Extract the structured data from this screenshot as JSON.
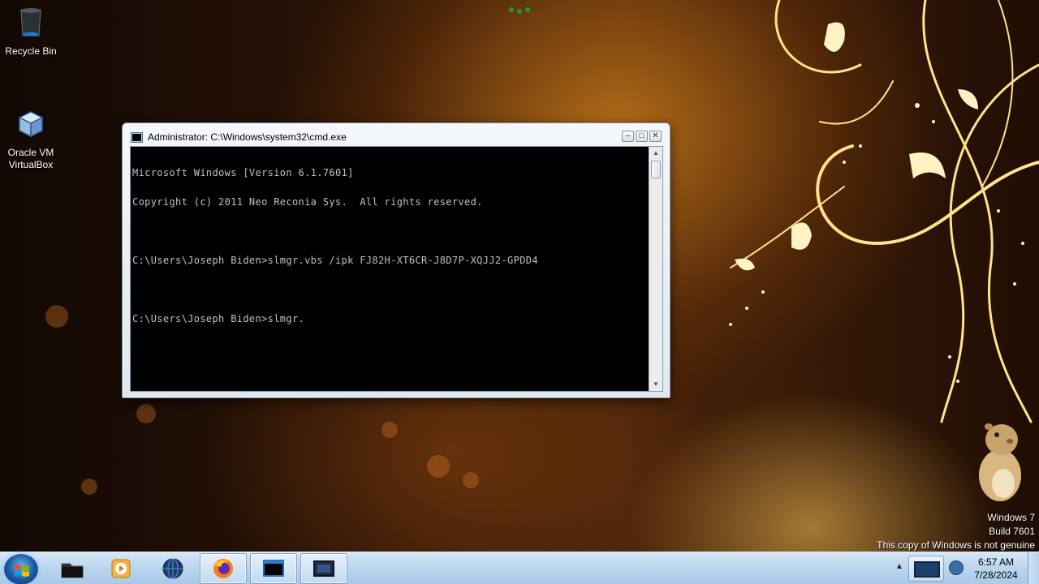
{
  "desktop": {
    "icons": [
      {
        "label": "Recycle Bin",
        "icon": "recycle-bin-icon"
      },
      {
        "label": "Oracle VM\nVirtualBox",
        "icon": "virtualbox-icon"
      }
    ]
  },
  "cmd_window": {
    "title": "Administrator: C:\\Windows\\system32\\cmd.exe",
    "lines": [
      "Microsoft Windows [Version 6.1.7601]",
      "Copyright (c) 2011 Neo Reconia Sys.  All rights reserved.",
      "",
      "C:\\Users\\Joseph Biden>slmgr.vbs /ipk FJ82H-XT6CR-J8D7P-XQJJ2-GPDD4",
      "",
      "C:\\Users\\Joseph Biden>slmgr."
    ],
    "buttons": {
      "minimize": "–",
      "maximize": "□",
      "close": "✕"
    },
    "scroll": {
      "up": "▲",
      "down": "▼"
    }
  },
  "watermark": {
    "line1": "Windows 7",
    "line2": "Build 7601",
    "line3": "This copy of Windows is not genuine"
  },
  "taskbar": {
    "pinned": [
      {
        "name": "explorer",
        "icon": "folder-icon"
      },
      {
        "name": "media-player",
        "icon": "media-player-icon"
      },
      {
        "name": "ie",
        "icon": "globe-icon"
      },
      {
        "name": "firefox",
        "icon": "firefox-icon"
      },
      {
        "name": "cmd",
        "icon": "cmd-icon"
      },
      {
        "name": "virtualbox",
        "icon": "virtualbox-icon"
      }
    ],
    "tray": {
      "expand": "▲",
      "time": "6:57 AM",
      "date": "7/28/2024"
    }
  },
  "colors": {
    "console_bg": "#000000",
    "console_fg": "#c0c0c0",
    "taskbar": "#bcd6ee"
  }
}
